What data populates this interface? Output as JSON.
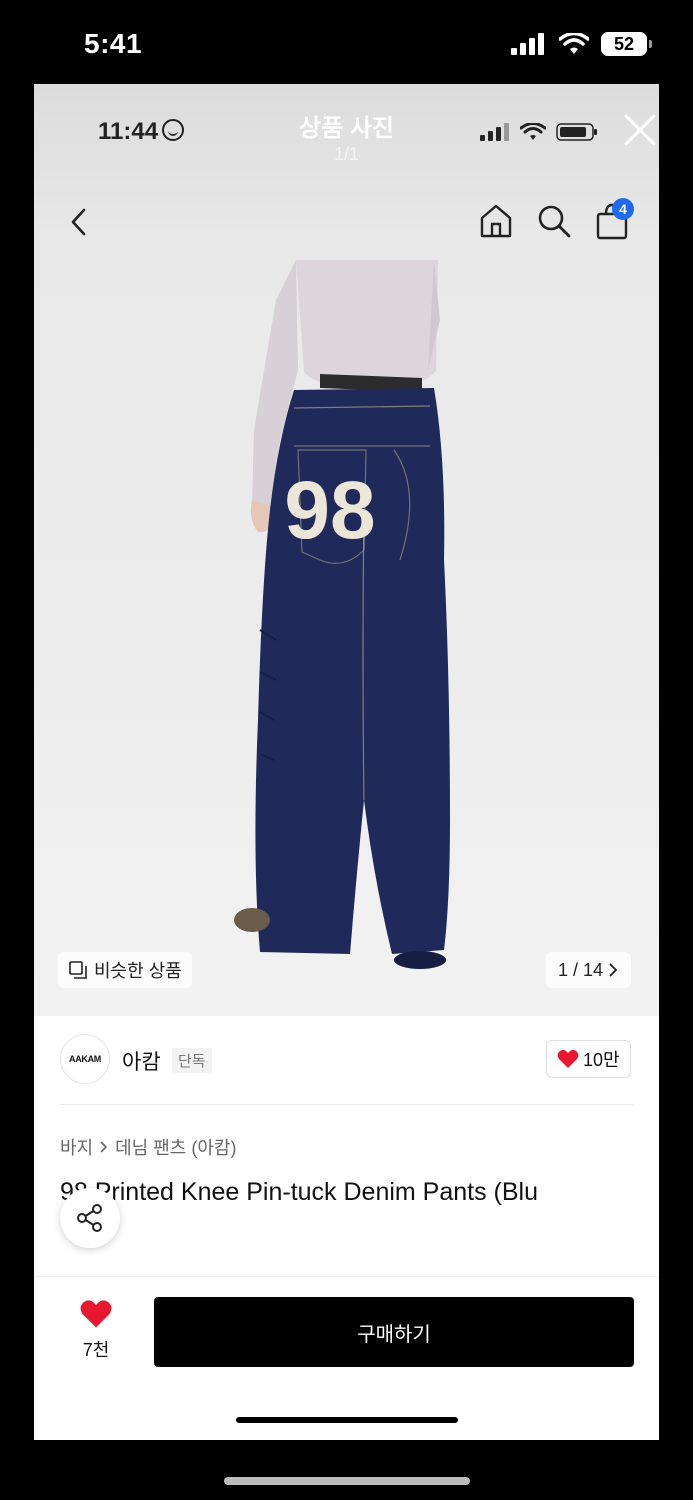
{
  "outer_status": {
    "time": "5:41",
    "battery": "52"
  },
  "viewer": {
    "inner_time": "11:44",
    "title": "상품 사진",
    "count": "1/1"
  },
  "nav": {
    "cart_badge": "4"
  },
  "gallery": {
    "similar_label": "비슷한 상품",
    "pager": "1 / 14"
  },
  "brand": {
    "logo_text": "AAKAM",
    "name": "아캄",
    "tag": "단독",
    "likes": "10만"
  },
  "product": {
    "category": "바지",
    "subcategory": "데님 팬츠 (아캄)",
    "title": "98 Printed Knee Pin-tuck Denim Pants (Blu",
    "back_print": "98"
  },
  "bottom": {
    "wish_count": "7천",
    "buy_label": "구매하기"
  },
  "colors": {
    "denim": "#1f2a5a",
    "badge": "#1f6bf0",
    "heart": "#e8182e",
    "buy_button": "#000000"
  }
}
